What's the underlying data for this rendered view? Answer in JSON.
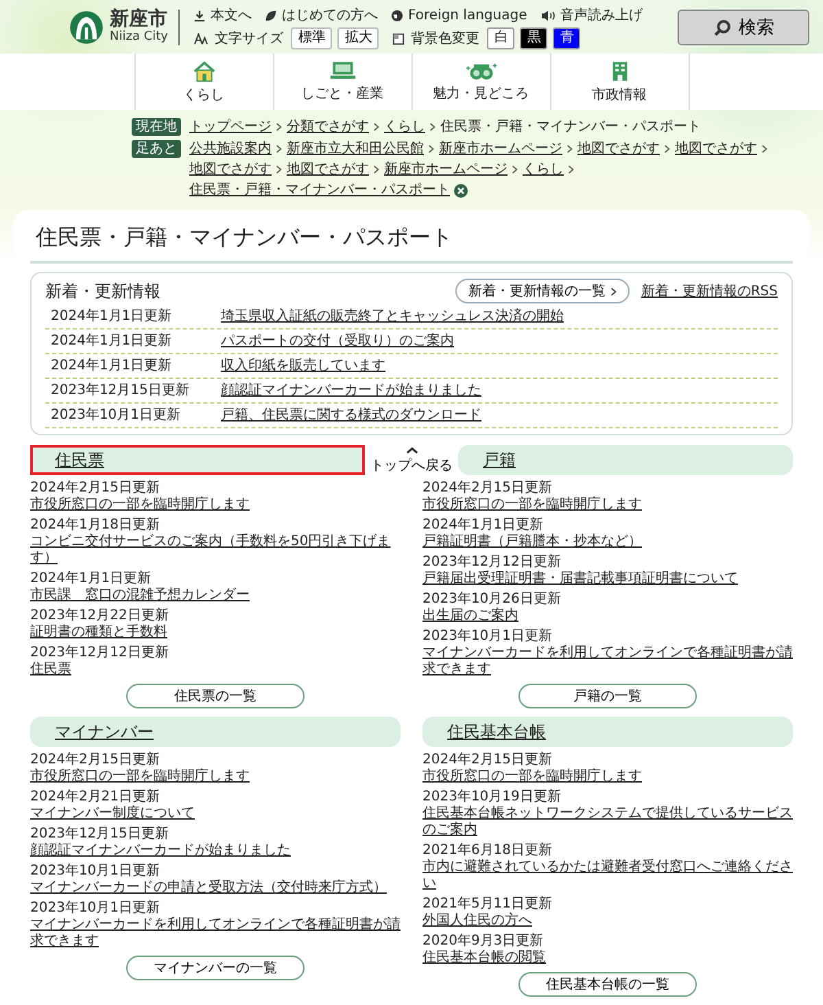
{
  "header": {
    "logo_title": "新座市",
    "logo_subtitle": "Niiza City",
    "utility_links": [
      {
        "label": "本文へ"
      },
      {
        "label": "はじめての方へ"
      },
      {
        "label": "Foreign language"
      },
      {
        "label": "音声読み上げ"
      }
    ],
    "font_size": {
      "label": "文字サイズ",
      "options": [
        {
          "label": "標準"
        },
        {
          "label": "拡大"
        }
      ]
    },
    "background": {
      "label": "背景色変更",
      "options": [
        {
          "label": "白",
          "color": "#ffffff"
        },
        {
          "label": "黒",
          "color": "#000000"
        },
        {
          "label": "青",
          "color": "#0000ff"
        }
      ]
    },
    "search_button": "検索"
  },
  "nav": [
    {
      "label": "くらし"
    },
    {
      "label": "しごと・産業"
    },
    {
      "label": "魅力・見どころ"
    },
    {
      "label": "市政情報"
    }
  ],
  "breadcrumbs": [
    {
      "kind": "current",
      "badge": "現在地",
      "items": [
        {
          "label": "トップページ",
          "link": true
        },
        {
          "label": "分類でさがす",
          "link": true
        },
        {
          "label": "くらし",
          "link": true
        },
        {
          "label": "住民票・戸籍・マイナンバー・パスポート",
          "link": false
        }
      ]
    },
    {
      "kind": "history",
      "badge": "足あと",
      "items": [
        {
          "label": "公共施設案内",
          "link": true
        },
        {
          "label": "新座市立大和田公民館",
          "link": true
        },
        {
          "label": "新座市ホームページ",
          "link": true
        },
        {
          "label": "地図でさがす",
          "link": true
        },
        {
          "label": "地図でさがす",
          "link": true
        },
        {
          "label": "地図でさがす",
          "link": true
        },
        {
          "label": "地図でさがす",
          "link": true
        },
        {
          "label": "新座市ホームページ",
          "link": true
        },
        {
          "label": "くらし",
          "link": true
        },
        {
          "label": "住民票・戸籍・マイナンバー・パスポート",
          "link": true
        }
      ]
    }
  ],
  "page_title": "住民票・戸籍・マイナンバー・パスポート",
  "news": {
    "title": "新着・更新情報",
    "list_button": "新着・更新情報の一覧",
    "rss_link": "新着・更新情報のRSS",
    "items": [
      {
        "date": "2024年1月1日更新",
        "title": "埼玉県収入証紙の販売終了とキャッシュレス決済の開始"
      },
      {
        "date": "2024年1月1日更新",
        "title": "パスポートの交付（受取り）のご案内"
      },
      {
        "date": "2024年1月1日更新",
        "title": "収入印紙を販売しています"
      },
      {
        "date": "2023年12月15日更新",
        "title": "顔認証マイナンバーカードが始まりました"
      },
      {
        "date": "2023年10月1日更新",
        "title": "戸籍、住民票に関する様式のダウンロード"
      }
    ]
  },
  "back_to_top": "トップへ戻る",
  "sections": [
    {
      "title": "住民票",
      "highlighted": true,
      "more": "住民票の一覧",
      "items": [
        {
          "date": "2024年2月15日更新",
          "title": "市役所窓口の一部を臨時開庁します"
        },
        {
          "date": "2024年1月18日更新",
          "title": "コンビニ交付サービスのご案内（手数料を50円引き下げます）"
        },
        {
          "date": "2024年1月1日更新",
          "title": "市民課　窓口の混雑予想カレンダー"
        },
        {
          "date": "2023年12月22日更新",
          "title": "証明書の種類と手数料"
        },
        {
          "date": "2023年12月12日更新",
          "title": "住民票"
        }
      ]
    },
    {
      "title": "戸籍",
      "highlighted": false,
      "more": "戸籍の一覧",
      "items": [
        {
          "date": "2024年2月15日更新",
          "title": "市役所窓口の一部を臨時開庁します"
        },
        {
          "date": "2024年1月1日更新",
          "title": "戸籍証明書（戸籍謄本・抄本など）"
        },
        {
          "date": "2023年12月12日更新",
          "title": "戸籍届出受理証明書・届書記載事項証明書について"
        },
        {
          "date": "2023年10月26日更新",
          "title": "出生届のご案内"
        },
        {
          "date": "2023年10月1日更新",
          "title": "マイナンバーカードを利用してオンラインで各種証明書が請求できます"
        }
      ]
    },
    {
      "title": "マイナンバー",
      "highlighted": false,
      "more": "マイナンバーの一覧",
      "items": [
        {
          "date": "2024年2月15日更新",
          "title": "市役所窓口の一部を臨時開庁します"
        },
        {
          "date": "2024年2月21日更新",
          "title": "マイナンバー制度について"
        },
        {
          "date": "2023年12月15日更新",
          "title": "顔認証マイナンバーカードが始まりました"
        },
        {
          "date": "2023年10月1日更新",
          "title": "マイナンバーカードの申請と受取方法（交付時来庁方式）"
        },
        {
          "date": "2023年10月1日更新",
          "title": "マイナンバーカードを利用してオンラインで各種証明書が請求できます"
        }
      ]
    },
    {
      "title": "住民基本台帳",
      "highlighted": false,
      "more": "住民基本台帳の一覧",
      "items": [
        {
          "date": "2024年2月15日更新",
          "title": "市役所窓口の一部を臨時開庁します"
        },
        {
          "date": "2023年10月19日更新",
          "title": "住民基本台帳ネットワークシステムで提供しているサービスのご案内"
        },
        {
          "date": "2021年6月18日更新",
          "title": "市内に避難されているかたは避難者受付窓口へご連絡ください"
        },
        {
          "date": "2021年5月11日更新",
          "title": "外国人住民の方へ"
        },
        {
          "date": "2020年9月3日更新",
          "title": "住民基本台帳の閲覧"
        }
      ]
    }
  ]
}
